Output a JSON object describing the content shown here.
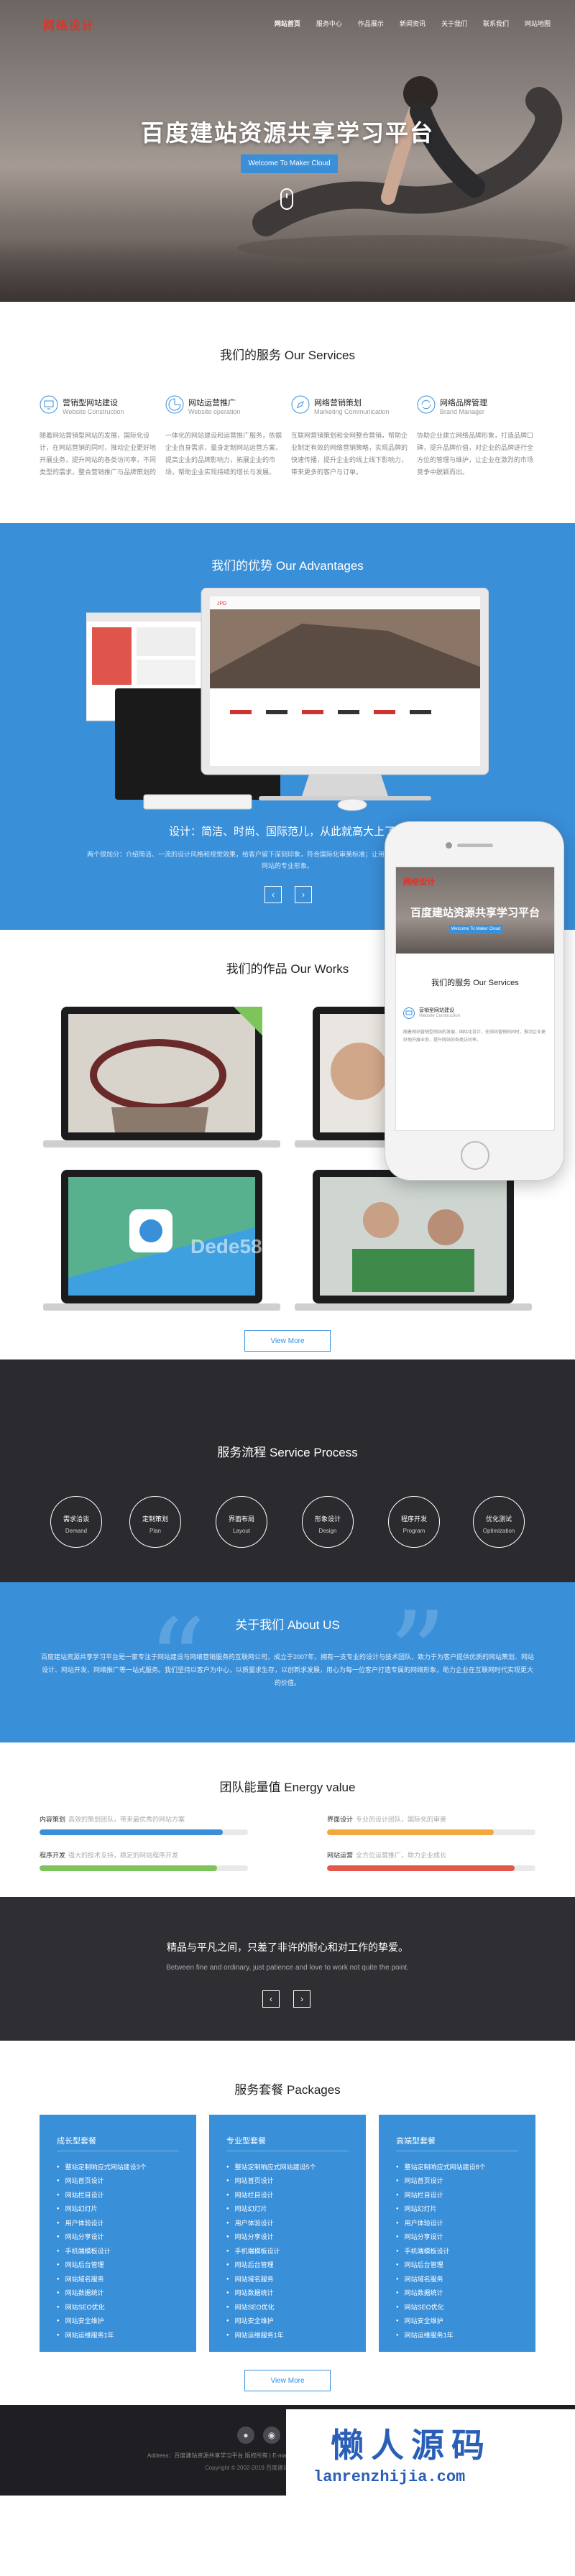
{
  "hero": {
    "logo": "网络设计",
    "nav": [
      "网站首页",
      "服务中心",
      "作品展示",
      "新闻资讯",
      "关于我们",
      "联系我们",
      "网站地图"
    ],
    "title": "百度建站资源共享学习平台",
    "button": "Welcome To Maker Cloud"
  },
  "services": {
    "title": "我们的服务 Our Services",
    "items": [
      {
        "name": "营销型网站建设",
        "en": "Website Construction",
        "icon": "monitor-icon",
        "desc": "随着网站营销型网站的发展，国际化设计，在网站营销的同时，推动企业更好地开展业务，提升网站的各类访问率，不同类型的需求，整合营销推广与品牌策划的服务。"
      },
      {
        "name": "网站运营推广",
        "en": "Website operation",
        "icon": "chart-icon",
        "desc": "一体化的网站建设和运营推广服务，依据企业自身需求，量身定制网站运营方案，提高企业的品牌影响力，拓展企业的市场，帮助企业实现持续的增长与发展。"
      },
      {
        "name": "网络营销策划",
        "en": "Marketing Communication",
        "icon": "compass-icon",
        "desc": "互联网营销策划和全网整合营销，帮助企业制定有效的网络营销策略，实现品牌的快速传播，提升企业的线上线下影响力，带来更多的客户与订单。"
      },
      {
        "name": "网络品牌管理",
        "en": "Brand Manager",
        "icon": "refresh-icon",
        "desc": "协助企业建立网络品牌形象，打造品牌口碑，提升品牌价值，对企业的品牌进行全方位的管理与维护，让企业在激烈的市场竞争中脱颖而出。"
      }
    ]
  },
  "advantages": {
    "title": "我们的优势 Our Advantages",
    "subtitle": "设计：简洁、时尚、国际范儿，从此就高大上了。",
    "desc": "两个很加分：介绍简洁、一流的设计风格和视觉效果，给客户留下深刻印象，符合国际化审美标准；让用户能够轻松找到所需信息，还能提升网站的专业形象。"
  },
  "works": {
    "title": "我们的作品 Our Works",
    "button": "View More",
    "watermark": "Dede58.com"
  },
  "process": {
    "title": "服务流程 Service Process",
    "steps": [
      {
        "cn": "需求洽谈",
        "en": "Demand"
      },
      {
        "cn": "定制策划",
        "en": "Plan"
      },
      {
        "cn": "界面布局",
        "en": "Layout"
      },
      {
        "cn": "形象设计",
        "en": "Design"
      },
      {
        "cn": "程序开发",
        "en": "Program"
      },
      {
        "cn": "优化测试",
        "en": "Optimization"
      }
    ]
  },
  "about": {
    "title": "关于我们 About US",
    "text": "百度建站资源共享学习平台是一家专注于网站建设与网络营销服务的互联网公司，成立于2007年，拥有一支专业的设计与技术团队，致力于为客户提供优质的网站策划、网站设计、网站开发、网络推广等一站式服务。我们坚持以客户为中心，以质量求生存，以创新求发展，用心为每一位客户打造专属的网络形象，助力企业在互联网时代实现更大的价值。"
  },
  "energy": {
    "title": "团队能量值 Energy value",
    "bars": [
      {
        "label": "内容策划",
        "sub": "高效的策划团队，带来最优秀的网站方案",
        "value": 0.88,
        "color": "#3a8fd9"
      },
      {
        "label": "界面设计",
        "sub": "专业的设计团队，国际化的审美",
        "value": 0.8,
        "color": "#f0a93a"
      },
      {
        "label": "程序开发",
        "sub": "强大的技术支持，稳定的网站程序开发",
        "value": 0.85,
        "color": "#7dc55a"
      },
      {
        "label": "网站运营",
        "sub": "全方位运营推广，助力企业成长",
        "value": 0.9,
        "color": "#e3574b"
      }
    ]
  },
  "quote": {
    "cn": "精品与平凡之间，只差了非许的耐心和对工作的挚爱。",
    "en": "Between fine and ordinary, just patience and love to work not quite the point."
  },
  "packages": {
    "title": "服务套餐 Packages",
    "button": "View More",
    "cards": [
      {
        "title": "成长型套餐",
        "items": [
          "整站定制响应式网站建设3个",
          "网站首页设计",
          "网站栏目设计",
          "网站幻灯片",
          "用户体验设计",
          "网站分享设计",
          "手机端模板设计",
          "网站后台管理",
          "网站域名服务",
          "网站数据统计",
          "网站SEO优化",
          "网站安全维护",
          "网站运维服务1年"
        ]
      },
      {
        "title": "专业型套餐",
        "items": [
          "整站定制响应式网站建设5个",
          "网站首页设计",
          "网站栏目设计",
          "网站幻灯片",
          "用户体验设计",
          "网站分享设计",
          "手机端模板设计",
          "网站后台管理",
          "网站域名服务",
          "网站数据统计",
          "网站SEO优化",
          "网站安全维护",
          "网站运维服务1年"
        ]
      },
      {
        "title": "高端型套餐",
        "items": [
          "整站定制响应式网站建设8个",
          "网站首页设计",
          "网站栏目设计",
          "网站幻灯片",
          "用户体验设计",
          "网站分享设计",
          "手机端模板设计",
          "网站后台管理",
          "网站域名服务",
          "网站数据统计",
          "网站SEO优化",
          "网站安全维护",
          "网站运维服务1年"
        ]
      }
    ]
  },
  "footer": {
    "line1": "Address：百度建站资源共享学习平台 版权所有 | E-mail：admin@qq.com | 电话：400-888-8888",
    "line2": "Copyright © 2002-2019 百度建站资源共享学习平台 版权所有"
  },
  "watermark": {
    "cn": "懒人源码",
    "url": "lanrenzhijia.com"
  },
  "phone": {
    "logo": "网络设计",
    "title": "百度建站资源共享学习平台",
    "button": "Welcome To Maker Cloud",
    "section": "我们的服务 Our Services",
    "svc_name": "营销型网站建设",
    "svc_en": "Website Construction",
    "svc_desc": "随着网站营销型网站的发展，国际化设计，在网站营销的同时，推动企业更好地开展业务，提升网站的各类访问率。"
  }
}
